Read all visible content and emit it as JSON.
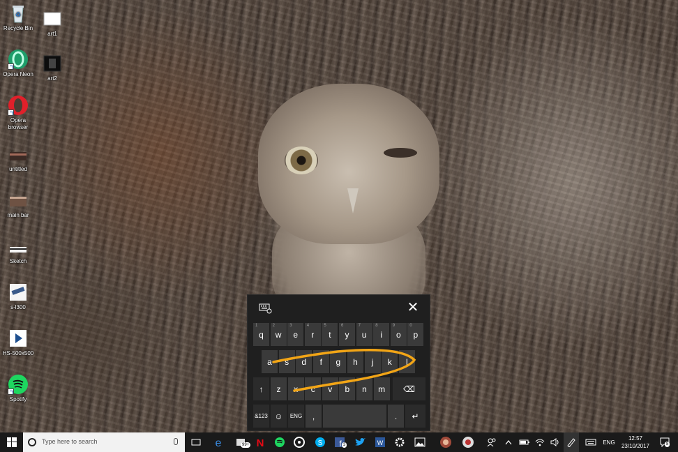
{
  "desktop": {
    "icons": [
      {
        "label": "Recycle Bin"
      },
      {
        "label": "art1"
      },
      {
        "label": "Opera Neon"
      },
      {
        "label": "art2"
      },
      {
        "label": "Opera browser"
      },
      {
        "label": "untitled"
      },
      {
        "label": "main bar"
      },
      {
        "label": "Sketch"
      },
      {
        "label": "s-l300"
      },
      {
        "label": "HS-500x500"
      },
      {
        "label": "Spotify"
      }
    ]
  },
  "keyboard": {
    "row1": [
      {
        "key": "q",
        "num": "1"
      },
      {
        "key": "w",
        "num": "2"
      },
      {
        "key": "e",
        "num": "3"
      },
      {
        "key": "r",
        "num": "4"
      },
      {
        "key": "t",
        "num": "5"
      },
      {
        "key": "y",
        "num": "6"
      },
      {
        "key": "u",
        "num": "7"
      },
      {
        "key": "i",
        "num": "8"
      },
      {
        "key": "o",
        "num": "9"
      },
      {
        "key": "p",
        "num": "0"
      }
    ],
    "row2": [
      "a",
      "s",
      "d",
      "f",
      "g",
      "h",
      "j",
      "k",
      "l"
    ],
    "row3": [
      "z",
      "x",
      "c",
      "v",
      "b",
      "n",
      "m"
    ],
    "symbols_label": "&123",
    "lang_label": "ENG",
    "comma": ",",
    "period": ".",
    "swipe_color": "#f2a516"
  },
  "taskbar": {
    "search_placeholder": "Type here to search",
    "badges": {
      "notifications": "99+",
      "facebook": "3",
      "action_center": "8"
    },
    "language": "ENG",
    "time": "12:57",
    "date": "23/10/2017"
  }
}
